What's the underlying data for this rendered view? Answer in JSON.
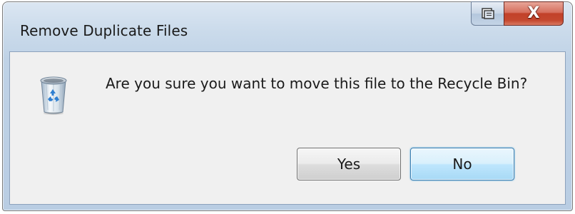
{
  "window": {
    "title": "Remove Duplicate Files"
  },
  "caption_buttons": {
    "help_icon": "context-help-icon",
    "close_label": "X"
  },
  "dialog": {
    "icon": "recycle-bin-icon",
    "message": "Are you sure you want to move this file to the Recycle Bin?",
    "buttons": {
      "yes_label": "Yes",
      "no_label": "No"
    },
    "default_button": "No"
  },
  "colors": {
    "frame": "#c4d4e6",
    "close_button": "#c24129",
    "client_background": "#f0f0f0",
    "default_button_border": "#3c7fb1"
  }
}
